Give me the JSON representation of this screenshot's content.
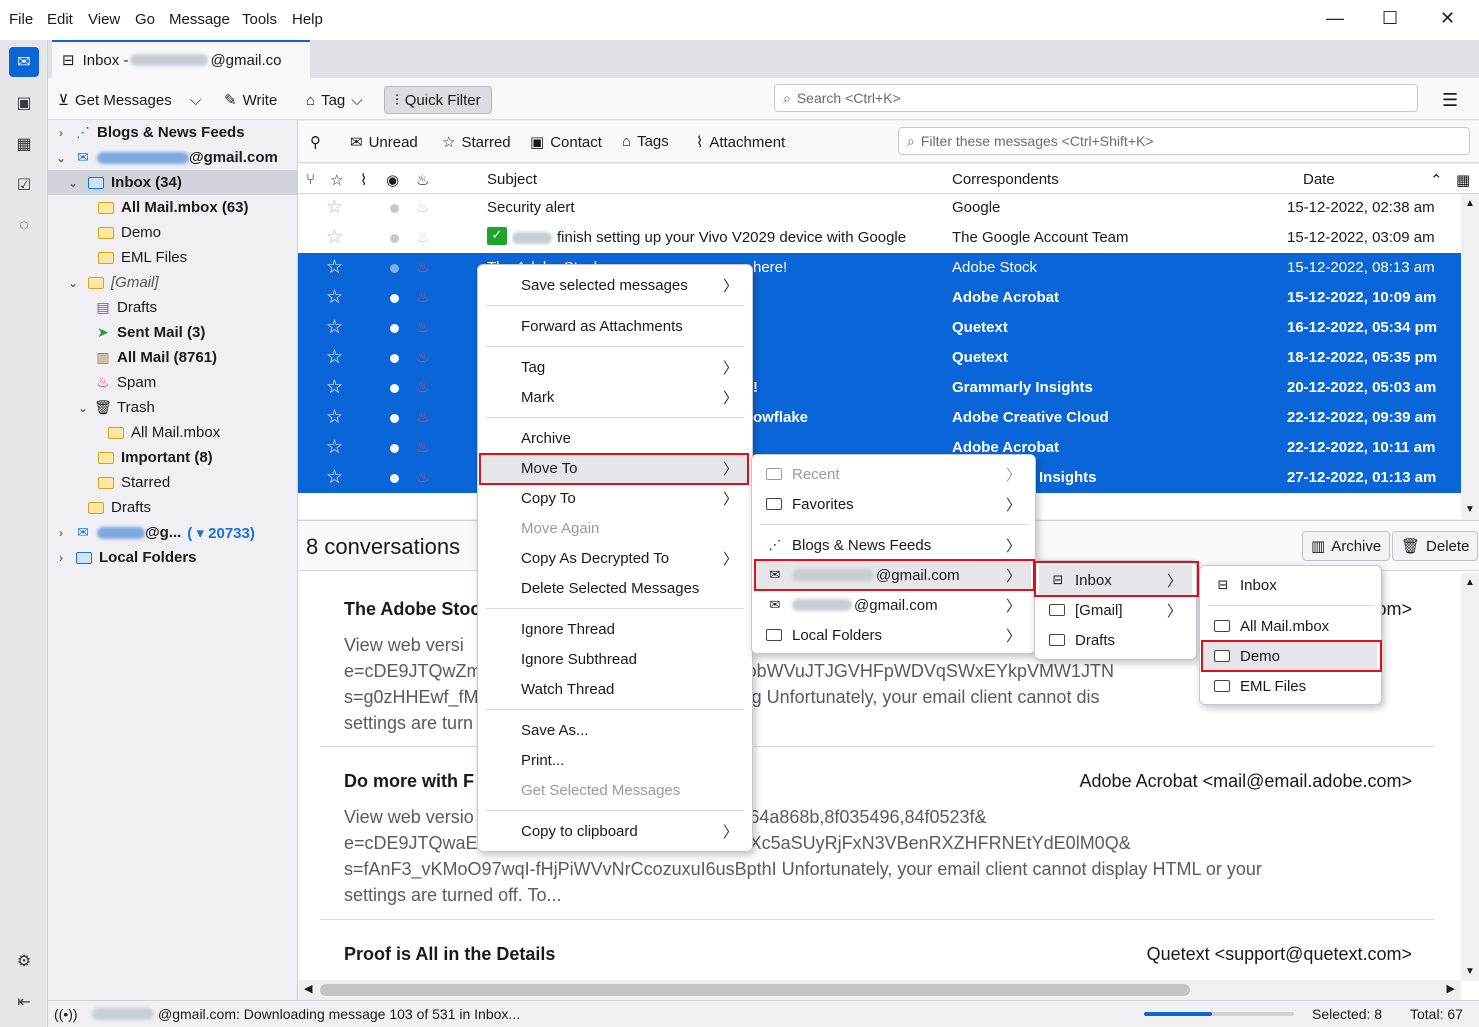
{
  "menubar": {
    "items": [
      "File",
      "Edit",
      "View",
      "Go",
      "Message",
      "Tools",
      "Help"
    ],
    "window_controls": {
      "minimize": "—",
      "maximize": "☐",
      "close": "✕"
    }
  },
  "tab": {
    "title_prefix": "Inbox - ",
    "account_suffix": "@gmail.co"
  },
  "toolbar": {
    "get_messages": "Get Messages",
    "write": "Write",
    "tag": "Tag",
    "quick_filter": "Quick Filter",
    "search_placeholder": "Search <Ctrl+K>"
  },
  "folders": {
    "blogs": "Blogs & News Feeds",
    "account1": "@gmail.com",
    "inbox": "Inbox (34)",
    "all_mail_mbox": "All Mail.mbox (63)",
    "demo": "Demo",
    "eml_files": "EML Files",
    "gmail": "[Gmail]",
    "drafts": "Drafts",
    "sent": "Sent Mail (3)",
    "all_mail": "All Mail (8761)",
    "spam": "Spam",
    "trash": "Trash",
    "trash_all_mail": "All Mail.mbox",
    "important": "Important (8)",
    "starred": "Starred",
    "drafts2": "Drafts",
    "account2": "@g...",
    "account2_count": "( ▾ 20733)",
    "local_folders": "Local Folders"
  },
  "quickfilter": {
    "unread": "Unread",
    "starred": "Starred",
    "contact": "Contact",
    "tags": "Tags",
    "attachment": "Attachment",
    "filter_placeholder": "Filter these messages <Ctrl+Shift+K>"
  },
  "columns": {
    "subject": "Subject",
    "correspondents": "Correspondents",
    "date": "Date"
  },
  "messages": [
    {
      "subject": "Security alert",
      "from": "Google",
      "date": "15-12-2022, 02:38 am"
    },
    {
      "subject": "finish setting up your Vivo V2029 device with Google",
      "from": "The Google Account Team",
      "date": "15-12-2022, 03:09 am"
    },
    {
      "subject": "The Adobe Stock",
      "subject_tail": "here!",
      "from": "Adobe Stock",
      "date": "15-12-2022, 08:13 am"
    },
    {
      "subject": "",
      "from": "Adobe Acrobat",
      "date": "15-12-2022, 10:09 am"
    },
    {
      "subject": "",
      "from": "Quetext",
      "date": "16-12-2022, 05:34 pm"
    },
    {
      "subject": "",
      "from": "Quetext",
      "date": "18-12-2022, 05:35 pm"
    },
    {
      "subject": "!",
      "from": "Grammarly Insights",
      "date": "20-12-2022, 05:03 am"
    },
    {
      "subject": "owflake",
      "from": "Adobe Creative Cloud",
      "date": "22-12-2022, 09:39 am"
    },
    {
      "subject": "",
      "from": "Adobe Acrobat",
      "date": "22-12-2022, 10:11 am"
    },
    {
      "subject": "",
      "from": "Insights",
      "date": "27-12-2022, 01:13 am"
    }
  ],
  "summary": {
    "count": "8 conversations",
    "archive": "Archive",
    "delete": "Delete",
    "items": [
      {
        "subject": "The Adobe Stoc",
        "from": "om>",
        "lines": [
          "View web versi",
          "e=cDE9JTQwZm                                        kZNdkNobWVuJTJGVHFpWDVqSWxEYkpVMW1JTN",
          "s=g0zHHEwf_fM                                        /bLRXZVg Unfortunately, your email client cannot dis",
          "settings are turn"
        ]
      },
      {
        "subject": "Do more with F",
        "from": "Adobe Acrobat <mail@email.adobe.com>",
        "lines": [
          "View web versio                                        n/r/?id=tb64a868b,8f035496,84f0523f&",
          "e=cDE9JTQwaE                                        McXVFNXc5aSUyRjFxN3VBenRXZHFRNEtYdE0lM0Q&",
          "s=fAnF3_vKMoO97wqI-fHjPiWVvNrCcozuxuI6usBpthI Unfortunately, your email client cannot display HTML or your",
          "settings are turned off. To..."
        ]
      },
      {
        "subject": "Proof is All in the Details",
        "from": "Quetext <support@quetext.com>",
        "lines": []
      }
    ]
  },
  "status": {
    "text": "@gmail.com: Downloading message 103 of 531 in Inbox...",
    "progress": 0.45,
    "selected": "Selected: 8",
    "total": "Total: 67"
  },
  "context_menu": {
    "save_selected": "Save selected messages",
    "forward_attach": "Forward as Attachments",
    "tag": "Tag",
    "mark": "Mark",
    "archive": "Archive",
    "move_to": "Move To",
    "copy_to": "Copy To",
    "move_again": "Move Again",
    "copy_decrypted": "Copy As Decrypted To",
    "delete_selected": "Delete Selected Messages",
    "ignore_thread": "Ignore Thread",
    "ignore_subthread": "Ignore Subthread",
    "watch_thread": "Watch Thread",
    "save_as": "Save As...",
    "print": "Print...",
    "get_selected": "Get Selected Messages",
    "copy_clipboard": "Copy to clipboard"
  },
  "move_menu": {
    "recent": "Recent",
    "favorites": "Favorites",
    "blogs": "Blogs & News Feeds",
    "account1": "@gmail.com",
    "account2": "@gmail.com",
    "local": "Local Folders"
  },
  "account_menu": {
    "inbox": "Inbox",
    "gmail": "[Gmail]",
    "drafts": "Drafts"
  },
  "inbox_menu": {
    "inbox": "Inbox",
    "all_mail": "All Mail.mbox",
    "demo": "Demo",
    "eml": "EML Files"
  }
}
